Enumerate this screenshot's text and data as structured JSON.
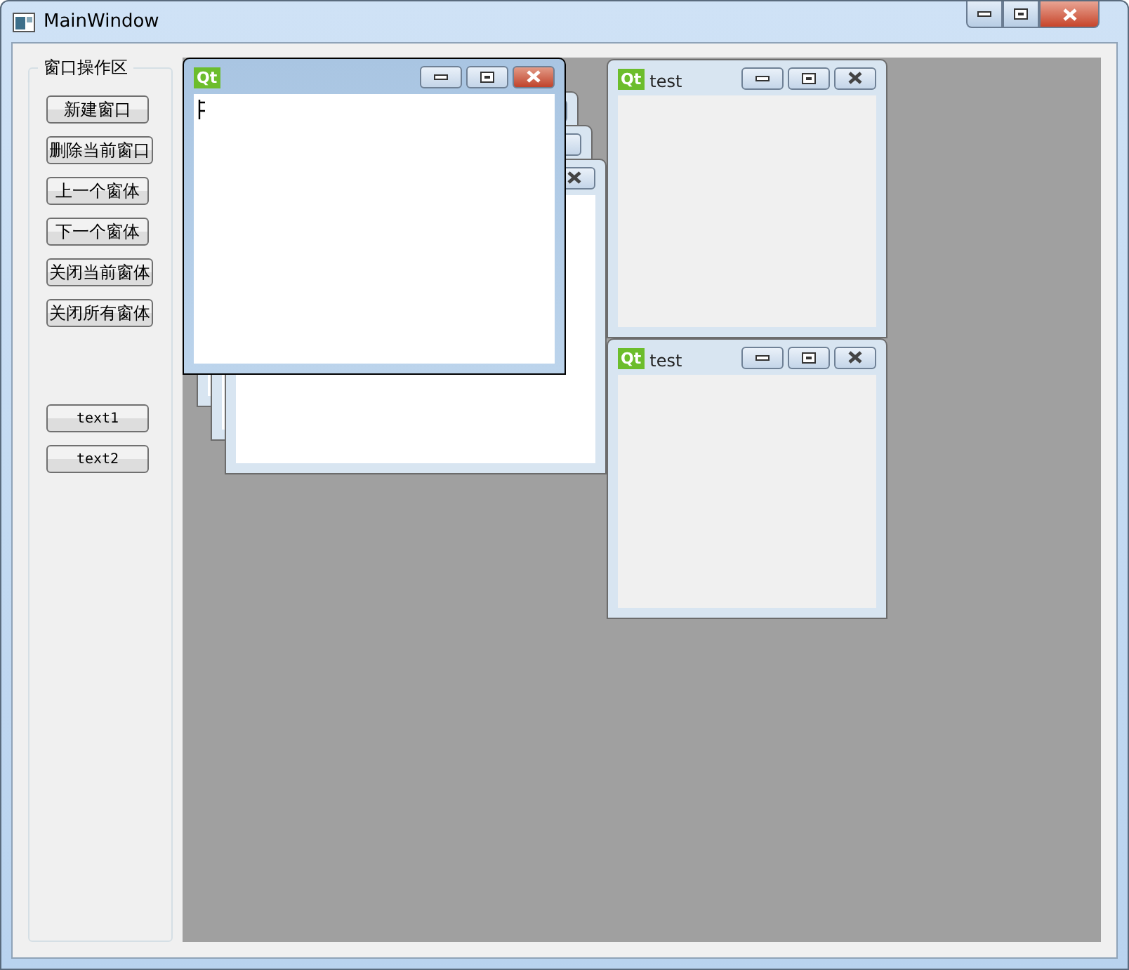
{
  "window": {
    "title": "MainWindow"
  },
  "group_box": {
    "title": "窗口操作区",
    "buttons": [
      {
        "label": "新建窗口"
      },
      {
        "label": "删除当前窗口"
      },
      {
        "label": "上一个窗体"
      },
      {
        "label": "下一个窗体"
      },
      {
        "label": "关闭当前窗体"
      },
      {
        "label": "关闭所有窗体"
      }
    ],
    "extra_buttons": [
      {
        "label": "text1"
      },
      {
        "label": "text2"
      }
    ]
  },
  "subwindows": [
    {
      "kind": "cascade",
      "active": false
    },
    {
      "kind": "cascade",
      "active": false
    },
    {
      "kind": "cascade",
      "active": false
    },
    {
      "kind": "editor",
      "active": true,
      "logo": "Qt"
    },
    {
      "kind": "plain",
      "active": false,
      "logo": "Qt",
      "title": "test"
    },
    {
      "kind": "plain",
      "active": false,
      "logo": "Qt",
      "title": "test"
    }
  ]
}
